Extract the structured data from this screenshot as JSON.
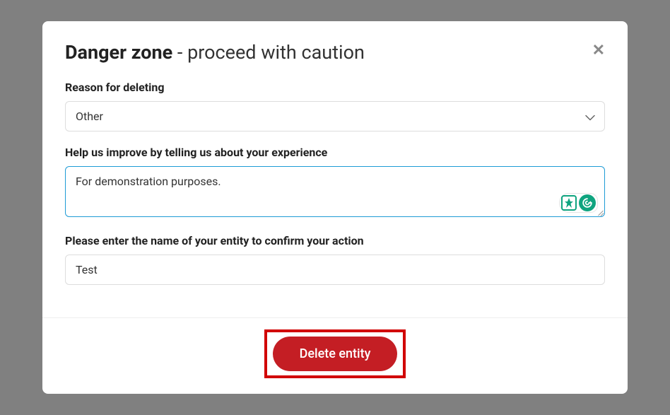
{
  "modal": {
    "title_bold": "Danger zone",
    "title_rest": " - proceed with caution",
    "reason": {
      "label": "Reason for deleting",
      "selected": "Other"
    },
    "feedback": {
      "label": "Help us improve by telling us about your experience",
      "value": "For demonstration purposes."
    },
    "confirm": {
      "label": "Please enter the name of your entity to confirm your action",
      "value": "Test"
    },
    "delete_button": "Delete entity"
  }
}
